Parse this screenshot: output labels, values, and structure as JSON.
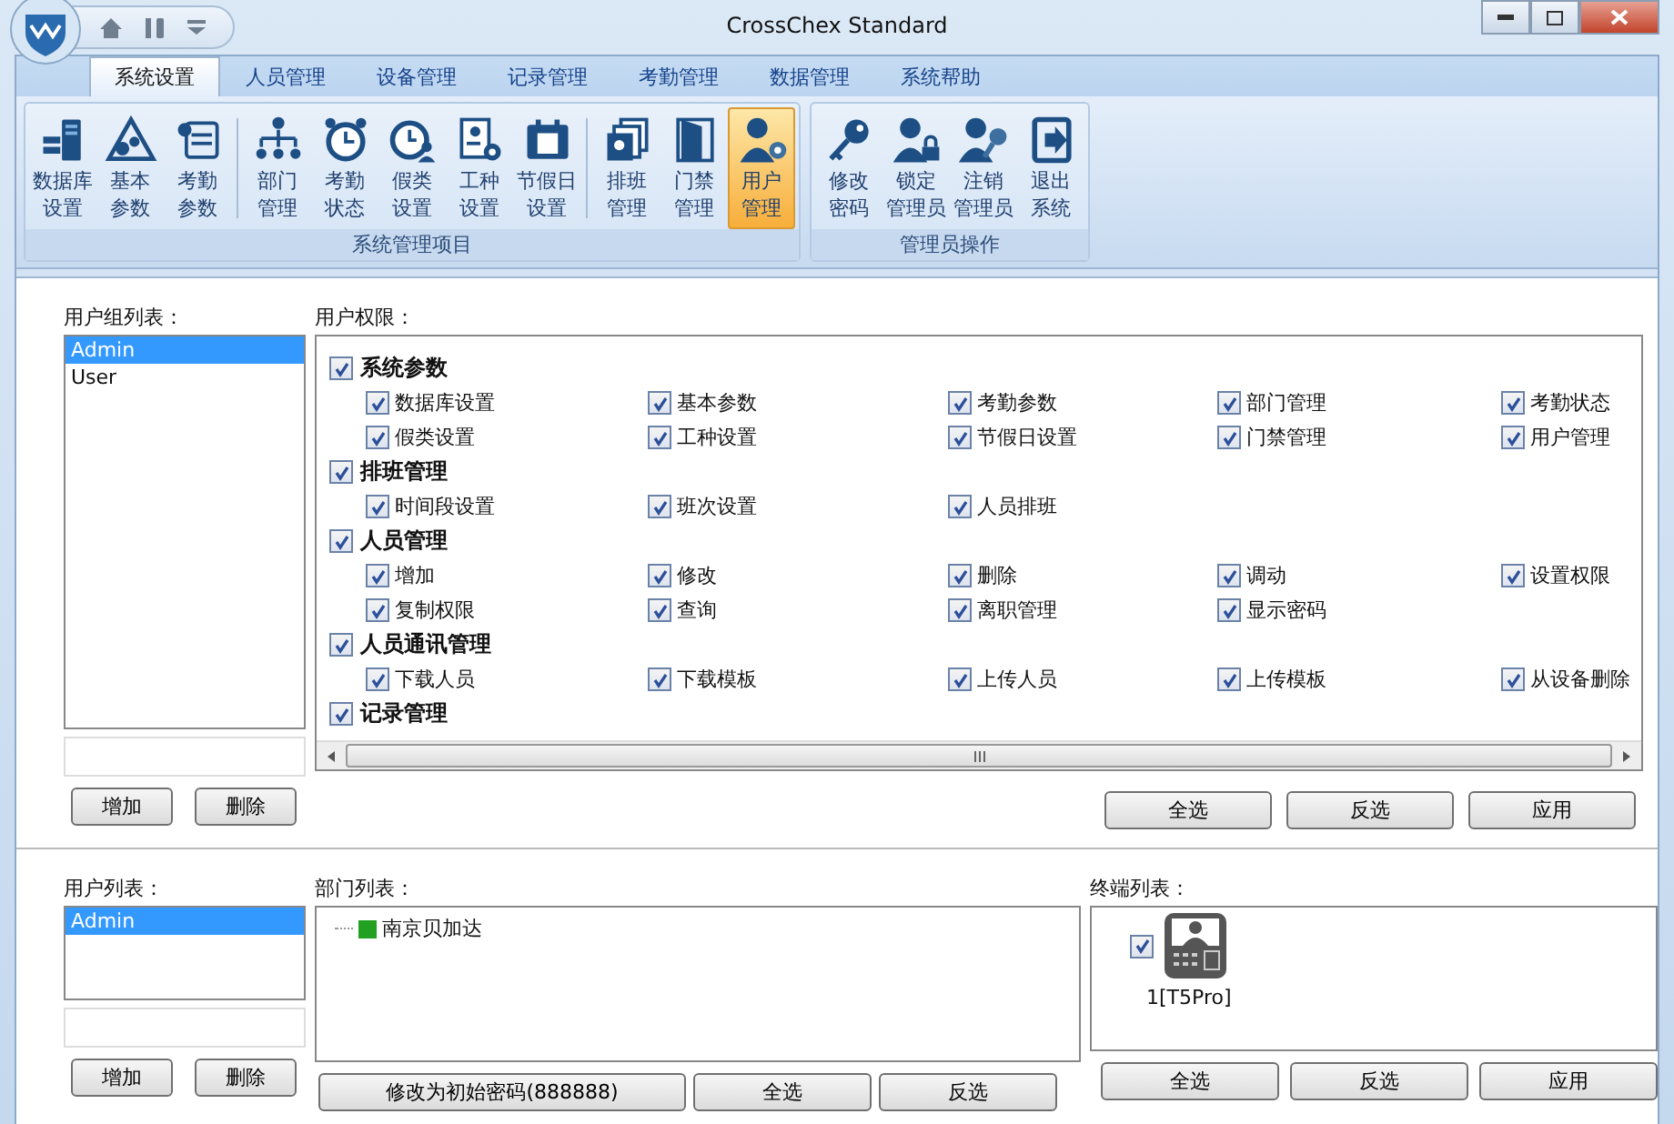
{
  "window": {
    "title": "CrossChex Standard"
  },
  "tabs": [
    {
      "label": "系统设置",
      "selected": true
    },
    {
      "label": "人员管理",
      "selected": false
    },
    {
      "label": "设备管理",
      "selected": false
    },
    {
      "label": "记录管理",
      "selected": false
    },
    {
      "label": "考勤管理",
      "selected": false
    },
    {
      "label": "数据管理",
      "selected": false
    },
    {
      "label": "系统帮助",
      "selected": false
    }
  ],
  "ribbon": {
    "groups": [
      {
        "label": "系统管理项目",
        "sections": [
          [
            {
              "lines": [
                "数据库",
                "设置"
              ],
              "selected": false
            },
            {
              "lines": [
                "基本",
                "参数"
              ],
              "selected": false
            },
            {
              "lines": [
                "考勤",
                "参数"
              ],
              "selected": false
            }
          ],
          [
            {
              "lines": [
                "部门",
                "管理"
              ],
              "selected": false
            },
            {
              "lines": [
                "考勤",
                "状态"
              ],
              "selected": false
            },
            {
              "lines": [
                "假类",
                "设置"
              ],
              "selected": false
            },
            {
              "lines": [
                "工种",
                "设置"
              ],
              "selected": false
            },
            {
              "lines": [
                "节假日",
                "设置"
              ],
              "selected": false
            }
          ],
          [
            {
              "lines": [
                "排班",
                "管理"
              ],
              "selected": false
            },
            {
              "lines": [
                "门禁",
                "管理"
              ],
              "selected": false
            },
            {
              "lines": [
                "用户",
                "管理"
              ],
              "selected": true
            }
          ]
        ]
      },
      {
        "label": "管理员操作",
        "sections": [
          [
            {
              "lines": [
                "修改",
                "密码"
              ],
              "selected": false
            },
            {
              "lines": [
                "锁定",
                "管理员"
              ],
              "selected": false
            },
            {
              "lines": [
                "注销",
                "管理员"
              ],
              "selected": false
            },
            {
              "lines": [
                "退出",
                "系统"
              ],
              "selected": false
            }
          ]
        ]
      }
    ]
  },
  "user_groups": {
    "label": "用户组列表：",
    "items": [
      {
        "text": "Admin",
        "selected": true
      },
      {
        "text": "User",
        "selected": false
      }
    ],
    "buttons": [
      "增加",
      "删除"
    ]
  },
  "permissions": {
    "label": "用户权限：",
    "groups": [
      {
        "name": "系统参数",
        "checked": true,
        "items": [
          {
            "name": "数据库设置",
            "checked": true
          },
          {
            "name": "基本参数",
            "checked": true
          },
          {
            "name": "考勤参数",
            "checked": true
          },
          {
            "name": "部门管理",
            "checked": true
          },
          {
            "name": "考勤状态",
            "checked": true
          },
          {
            "name": "假类设置",
            "checked": true
          },
          {
            "name": "工种设置",
            "checked": true
          },
          {
            "name": "节假日设置",
            "checked": true
          },
          {
            "name": "门禁管理",
            "checked": true
          },
          {
            "name": "用户管理",
            "checked": true
          }
        ]
      },
      {
        "name": "排班管理",
        "checked": true,
        "items": [
          {
            "name": "时间段设置",
            "checked": true
          },
          {
            "name": "班次设置",
            "checked": true
          },
          {
            "name": "人员排班",
            "checked": true
          }
        ]
      },
      {
        "name": "人员管理",
        "checked": true,
        "items": [
          {
            "name": "增加",
            "checked": true
          },
          {
            "name": "修改",
            "checked": true
          },
          {
            "name": "删除",
            "checked": true
          },
          {
            "name": "调动",
            "checked": true
          },
          {
            "name": "设置权限",
            "checked": true
          },
          {
            "name": "复制权限",
            "checked": true
          },
          {
            "name": "查询",
            "checked": true
          },
          {
            "name": "离职管理",
            "checked": true
          },
          {
            "name": "显示密码",
            "checked": true
          }
        ]
      },
      {
        "name": "人员通讯管理",
        "checked": true,
        "items": [
          {
            "name": "下载人员",
            "checked": true
          },
          {
            "name": "下载模板",
            "checked": true
          },
          {
            "name": "上传人员",
            "checked": true
          },
          {
            "name": "上传模板",
            "checked": true
          },
          {
            "name": "从设备删除",
            "checked": true
          }
        ]
      },
      {
        "name": "记录管理",
        "checked": true
      }
    ],
    "buttons": [
      "全选",
      "反选",
      "应用"
    ]
  },
  "users": {
    "label": "用户列表：",
    "items": [
      {
        "text": "Admin",
        "selected": true
      }
    ],
    "buttons": [
      "增加",
      "删除"
    ]
  },
  "departments": {
    "label": "部门列表：",
    "tree": [
      {
        "name": "南京贝加达",
        "color": "#22a022"
      }
    ],
    "buttons": [
      "修改为初始密码(888888)",
      "全选",
      "反选"
    ]
  },
  "terminals": {
    "label": "终端列表：",
    "items": [
      {
        "name": "1[T5Pro]",
        "checked": true
      }
    ],
    "buttons": [
      "全选",
      "反选",
      "应用"
    ]
  }
}
